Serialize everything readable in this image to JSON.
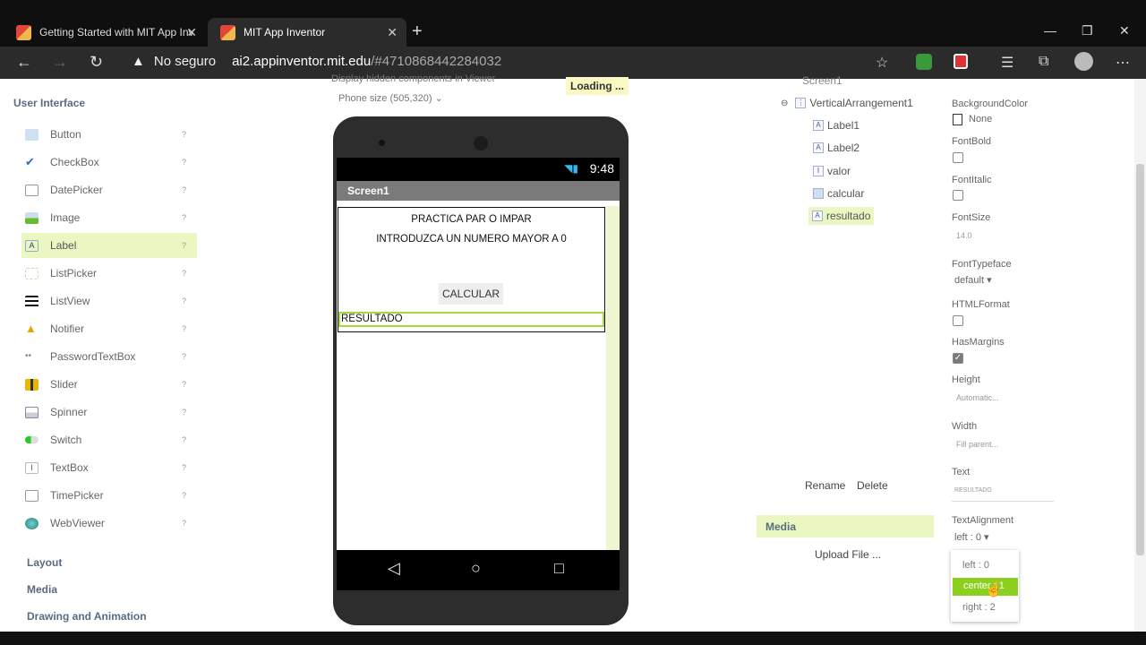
{
  "browser": {
    "tabs": [
      {
        "title": "Getting Started with MIT App Inv",
        "close": "✕"
      },
      {
        "title": "MIT App Inventor",
        "close": "✕"
      }
    ],
    "security": "No seguro",
    "url_host": "ai2.appinventor.mit.edu",
    "url_path": "/#4710868442284032"
  },
  "palette": {
    "heading": "User Interface",
    "items": [
      {
        "label": "Button",
        "icon": "button-icon"
      },
      {
        "label": "CheckBox",
        "icon": "checkbox-icon"
      },
      {
        "label": "DatePicker",
        "icon": "datepicker-icon"
      },
      {
        "label": "Image",
        "icon": "image-icon"
      },
      {
        "label": "Label",
        "icon": "label-icon"
      },
      {
        "label": "ListPicker",
        "icon": "listpicker-icon"
      },
      {
        "label": "ListView",
        "icon": "listview-icon"
      },
      {
        "label": "Notifier",
        "icon": "notifier-icon"
      },
      {
        "label": "PasswordTextBox",
        "icon": "password-icon"
      },
      {
        "label": "Slider",
        "icon": "slider-icon"
      },
      {
        "label": "Spinner",
        "icon": "spinner-icon"
      },
      {
        "label": "Switch",
        "icon": "switch-icon"
      },
      {
        "label": "TextBox",
        "icon": "textbox-icon"
      },
      {
        "label": "TimePicker",
        "icon": "timepicker-icon"
      },
      {
        "label": "WebViewer",
        "icon": "webviewer-icon"
      }
    ],
    "help_mark": "?",
    "categories": [
      "Layout",
      "Media",
      "Drawing and Animation"
    ]
  },
  "viewer": {
    "hidden_components": "Display hidden components in Viewer",
    "phone_size": "Phone size (505,320)",
    "loading": "Loading ...",
    "status_time": "9:48",
    "screen_title": "Screen1",
    "label1": "PRACTICA PAR O IMPAR",
    "label2": "INTRODUZCA UN NUMERO MAYOR A 0",
    "button": "CALCULAR",
    "resultado": "RESULTADO"
  },
  "components": {
    "root": "Screen1",
    "arrangement": "VerticalArrangement1",
    "children": [
      "Label1",
      "Label2",
      "valor",
      "calcular",
      "resultado"
    ],
    "rename": "Rename",
    "delete": "Delete",
    "media_heading": "Media",
    "upload": "Upload File ..."
  },
  "properties": {
    "background_color_label": "BackgroundColor",
    "background_color_value": "None",
    "font_bold": "FontBold",
    "font_italic": "FontItalic",
    "font_size": "FontSize",
    "font_size_value": "14.0",
    "font_typeface": "FontTypeface",
    "font_typeface_value": "default",
    "html_format": "HTMLFormat",
    "has_margins": "HasMargins",
    "height": "Height",
    "height_value": "Automatic...",
    "width": "Width",
    "width_value": "Fill parent...",
    "text": "Text",
    "text_value": "RESULTADO",
    "text_alignment": "TextAlignment",
    "text_alignment_value": "left : 0",
    "alignment_options": [
      "left : 0",
      "center : 1",
      "right : 2"
    ]
  }
}
